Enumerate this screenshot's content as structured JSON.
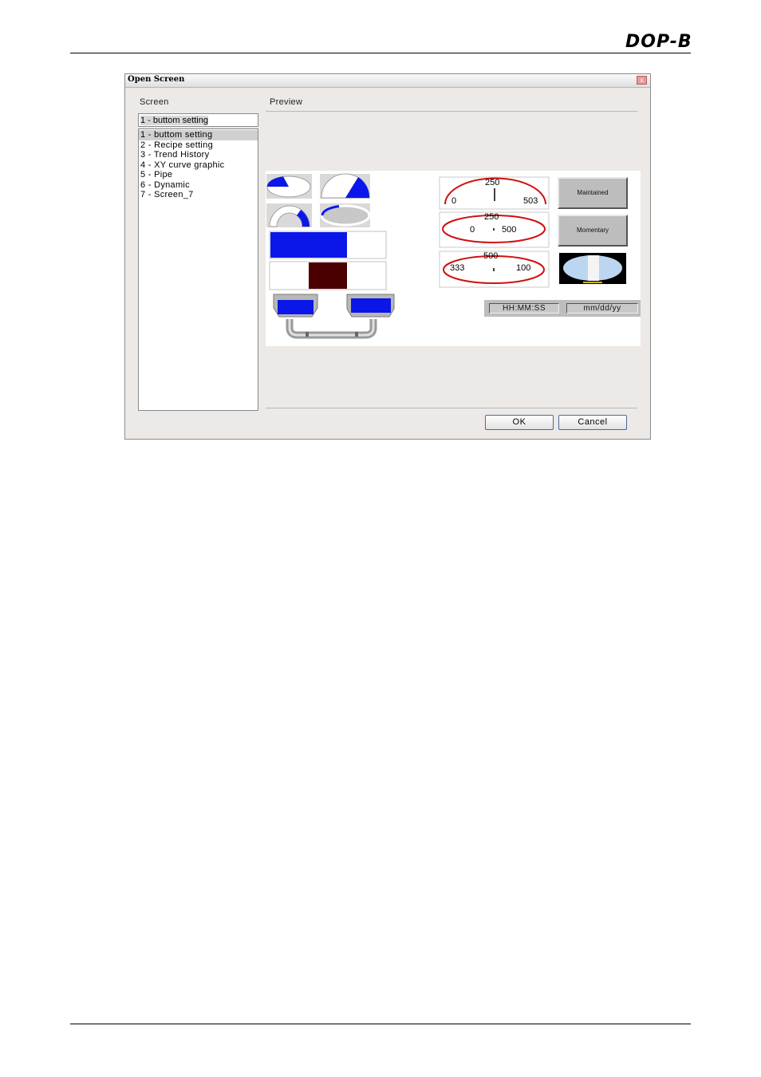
{
  "page": {
    "logo": "DOP-B"
  },
  "dialog": {
    "title": "Open Screen",
    "close_label": "x",
    "screen_label": "Screen",
    "preview_label": "Preview",
    "selected_value": "1 - buttom setting",
    "screens": [
      "1 - buttom setting",
      "2 - Recipe setting",
      "3 - Trend History",
      "4 - XY curve graphic",
      "5 - Pipe",
      "6 - Dynamic",
      "7 - Screen_7"
    ],
    "ok_label": "OK",
    "cancel_label": "Cancel"
  },
  "preview": {
    "meter1": {
      "top": "250",
      "left": "0",
      "right": "503"
    },
    "meter2": {
      "top": "250",
      "left": "0",
      "right": "500"
    },
    "meter3": {
      "top": "500",
      "left": "333",
      "right": "100"
    },
    "btn_maintained": "Maintained",
    "btn_momentary": "Momentary",
    "time_label": "HH:MM:SS",
    "date_label": "mm/dd/yy",
    "colors": {
      "blue": "#0b17e8",
      "dark_red": "#4a0000",
      "needle_red": "#d01010"
    }
  }
}
